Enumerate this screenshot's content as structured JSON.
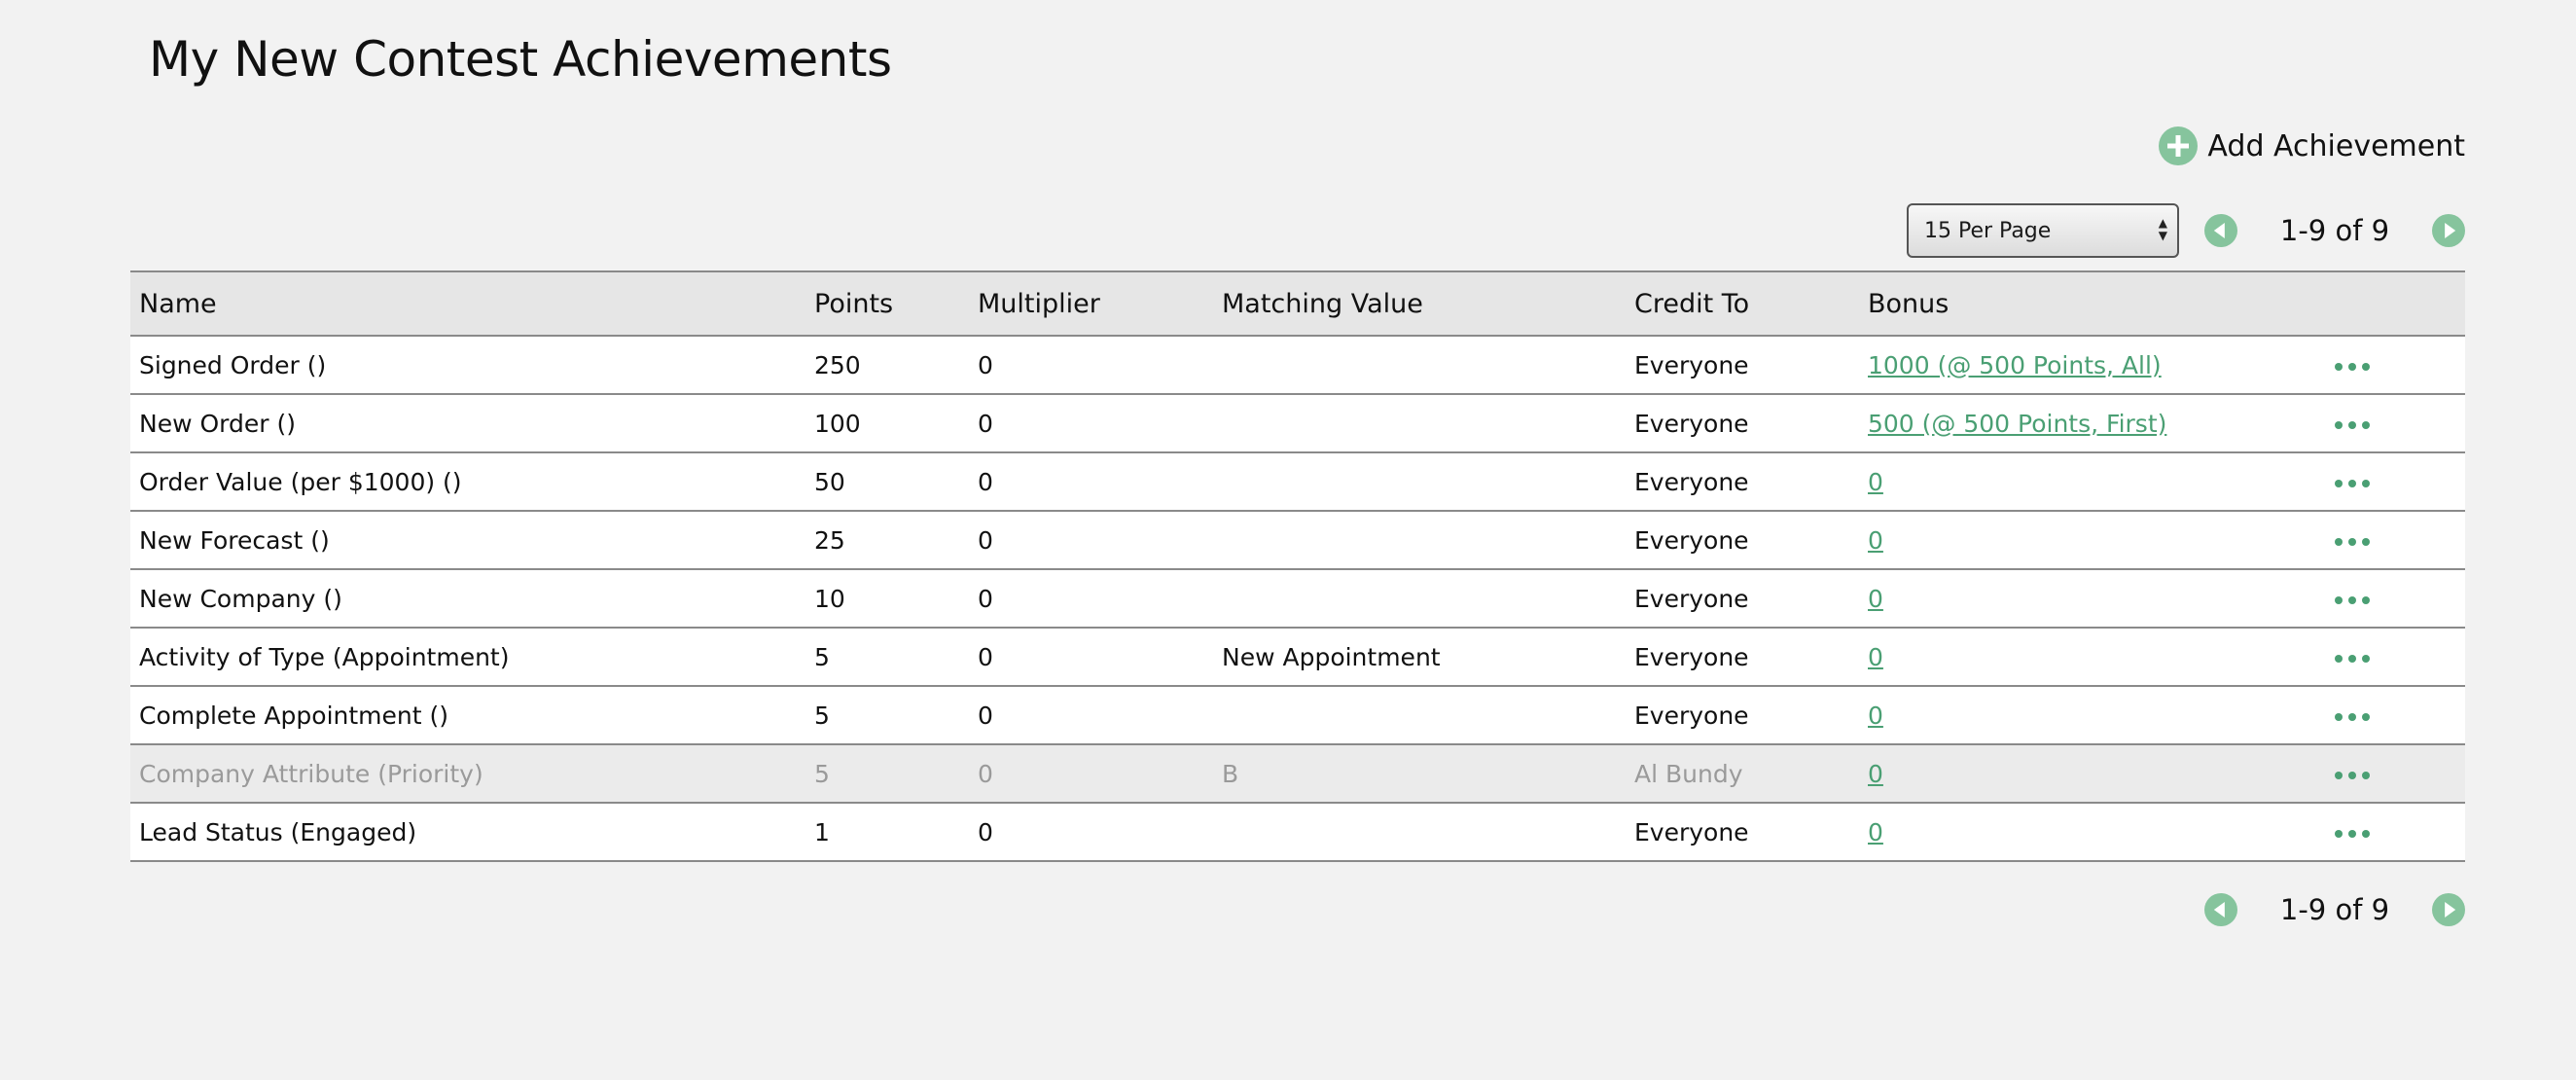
{
  "page": {
    "title": "My New Contest Achievements"
  },
  "toolbar": {
    "add_label": "Add Achievement",
    "add_icon": "plus-circle-icon"
  },
  "pagination": {
    "per_page": "15 Per Page",
    "range": "1-9 of 9",
    "prev_icon": "chevron-left-icon",
    "next_icon": "chevron-right-icon"
  },
  "table": {
    "columns": [
      "Name",
      "Points",
      "Multiplier",
      "Matching Value",
      "Credit To",
      "Bonus"
    ],
    "rows": [
      {
        "name": "Signed Order ()",
        "points": "250",
        "multiplier": "0",
        "matching": "",
        "credit": "Everyone",
        "bonus": "1000 (@ 500 Points, All)",
        "disabled": false
      },
      {
        "name": "New Order ()",
        "points": "100",
        "multiplier": "0",
        "matching": "",
        "credit": "Everyone",
        "bonus": "500 (@ 500 Points, First)",
        "disabled": false
      },
      {
        "name": "Order Value (per $1000) ()",
        "points": "50",
        "multiplier": "0",
        "matching": "",
        "credit": "Everyone",
        "bonus": "0",
        "disabled": false
      },
      {
        "name": "New Forecast ()",
        "points": "25",
        "multiplier": "0",
        "matching": "",
        "credit": "Everyone",
        "bonus": "0",
        "disabled": false
      },
      {
        "name": "New Company ()",
        "points": "10",
        "multiplier": "0",
        "matching": "",
        "credit": "Everyone",
        "bonus": "0",
        "disabled": false
      },
      {
        "name": "Activity of Type (Appointment)",
        "points": "5",
        "multiplier": "0",
        "matching": "New Appointment",
        "credit": "Everyone",
        "bonus": "0",
        "disabled": false
      },
      {
        "name": "Complete Appointment ()",
        "points": "5",
        "multiplier": "0",
        "matching": "",
        "credit": "Everyone",
        "bonus": "0",
        "disabled": false
      },
      {
        "name": "Company Attribute (Priority)",
        "points": "5",
        "multiplier": "0",
        "matching": "B",
        "credit": "Al Bundy",
        "bonus": "0",
        "disabled": true
      },
      {
        "name": "Lead Status (Engaged)",
        "points": "1",
        "multiplier": "0",
        "matching": "",
        "credit": "Everyone",
        "bonus": "0",
        "disabled": false
      }
    ],
    "row_action_icon": "more-horizontal-icon"
  },
  "colors": {
    "accent": "#86c49d",
    "link": "#4a9f73",
    "background": "#f2f2f2",
    "header_row": "#e6e6e6",
    "disabled_row": "#ebebeb"
  }
}
